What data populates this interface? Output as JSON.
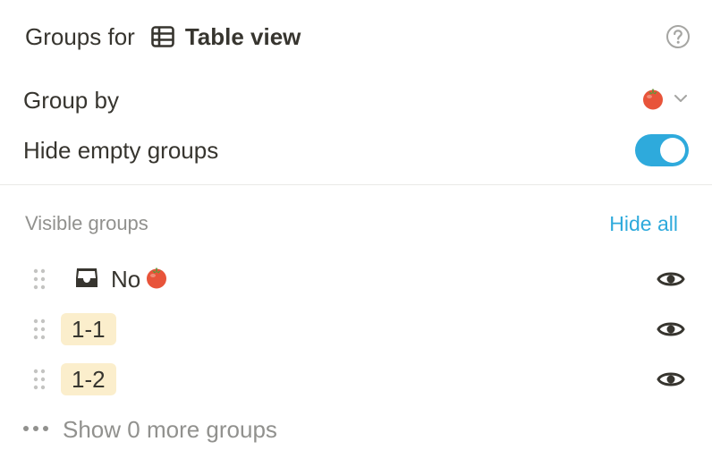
{
  "header": {
    "prefix": "Groups for",
    "view_name": "Table view",
    "view_icon": "table-icon",
    "help_icon": "question-circle-icon"
  },
  "settings": {
    "group_by_label": "Group by",
    "group_by_value_icon": "tomato-icon",
    "hide_empty_label": "Hide empty groups",
    "hide_empty_enabled": true,
    "toggle_color": "#2eaadc"
  },
  "visible_groups": {
    "title": "Visible groups",
    "hide_all_label": "Hide all",
    "accent": "#2eaadc",
    "groups": [
      {
        "kind": "empty",
        "label": "No",
        "icon": "inbox-icon",
        "emoji_icon": "tomato-icon"
      },
      {
        "kind": "tag",
        "label": "1-1",
        "tag_color": "#fbeecc"
      },
      {
        "kind": "tag",
        "label": "1-2",
        "tag_color": "#fbeecc"
      }
    ]
  },
  "footer": {
    "more_label": "Show 0 more groups",
    "more_icon": "ellipsis-icon"
  }
}
